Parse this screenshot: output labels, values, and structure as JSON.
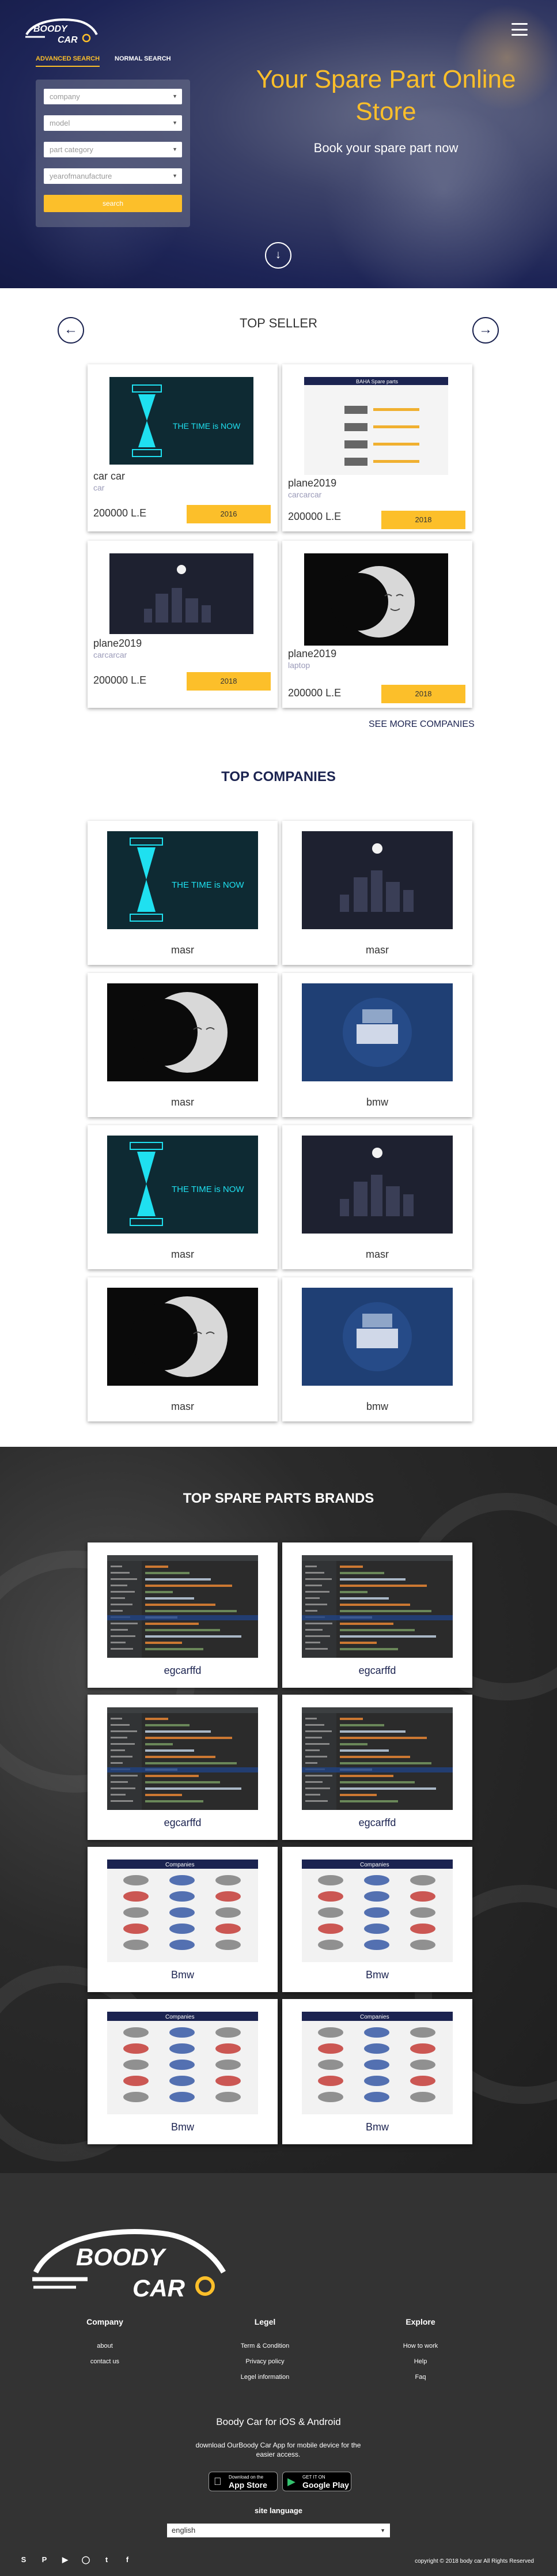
{
  "header": {
    "logo_text_1": "BOODY",
    "logo_text_2": "CAR",
    "tabs": [
      {
        "label": "ADVANCED SEARCH",
        "active": true
      },
      {
        "label": "NORMAL SEARCH",
        "active": false
      }
    ],
    "filters": [
      {
        "value": "company"
      },
      {
        "value": "model"
      },
      {
        "value": "part category"
      },
      {
        "value": "yearofmanufacture"
      }
    ],
    "search_label": "search",
    "title": "Your Spare Part Online Store",
    "subtitle": "Book your spare part now"
  },
  "top_seller": {
    "title": "TOP SELLER",
    "cards": [
      {
        "name": "car car",
        "category": "car",
        "price": "200000 L.E",
        "year": "2016",
        "image": "hourglass"
      },
      {
        "name": "plane2019",
        "category": "carcarcar",
        "price": "200000 L.E",
        "year": "2018",
        "image": "document"
      },
      {
        "name": "plane2019",
        "category": "carcarcar",
        "price": "200000 L.E",
        "year": "2018",
        "image": "night-city"
      },
      {
        "name": "plane2019",
        "category": "laptop",
        "price": "200000 L.E",
        "year": "2018",
        "image": "moon"
      }
    ],
    "more_label": "SEE MORE COMPANIES"
  },
  "top_companies": {
    "title": "TOP COMPANIES",
    "items": [
      {
        "label": "masr",
        "image": "hourglass"
      },
      {
        "label": "masr",
        "image": "night-city"
      },
      {
        "label": "masr",
        "image": "moon"
      },
      {
        "label": "bmw",
        "image": "blue-desk"
      },
      {
        "label": "masr",
        "image": "hourglass"
      },
      {
        "label": "masr",
        "image": "night-city"
      },
      {
        "label": "masr",
        "image": "moon"
      },
      {
        "label": "bmw",
        "image": "blue-desk"
      }
    ]
  },
  "brands": {
    "title": "TOP SPARE PARTS BRANDS",
    "items": [
      {
        "label": "egcarffd",
        "image": "code"
      },
      {
        "label": "egcarffd",
        "image": "code"
      },
      {
        "label": "egcarffd",
        "image": "code"
      },
      {
        "label": "egcarffd",
        "image": "code"
      },
      {
        "label": "Bmw",
        "image": "logos"
      },
      {
        "label": "Bmw",
        "image": "logos"
      },
      {
        "label": "Bmw",
        "image": "logos"
      },
      {
        "label": "Bmw",
        "image": "logos"
      }
    ]
  },
  "footer": {
    "logo_text_1": "BOODY",
    "logo_text_2": "CAR",
    "columns": [
      {
        "title": "Company",
        "links": [
          "about",
          "contact us"
        ]
      },
      {
        "title": "Legel",
        "links": [
          "Term & Condition",
          "Privacy policy",
          "Legel information"
        ]
      },
      {
        "title": "Explore",
        "links": [
          "How to work",
          "Help",
          "Faq"
        ]
      }
    ],
    "app_title": "Boody Car for iOS & Android",
    "app_sub": "download OurBoody Car App for mobile device for the easier access.",
    "app_store_small": "Download on the",
    "app_store_big": "App Store",
    "google_small": "GET IT ON",
    "google_big": "Google Play",
    "lang_title": "site language",
    "lang_value": "english",
    "socials": [
      "skype-icon",
      "pinterest-icon",
      "youtube-icon",
      "instagram-icon",
      "twitter-icon",
      "facebook-icon"
    ],
    "copyright": "copyright © 2018 body car All Rights Reserved"
  },
  "colors": {
    "accent": "#fcbf2a",
    "navy": "#1b2350",
    "footer": "#333333"
  }
}
